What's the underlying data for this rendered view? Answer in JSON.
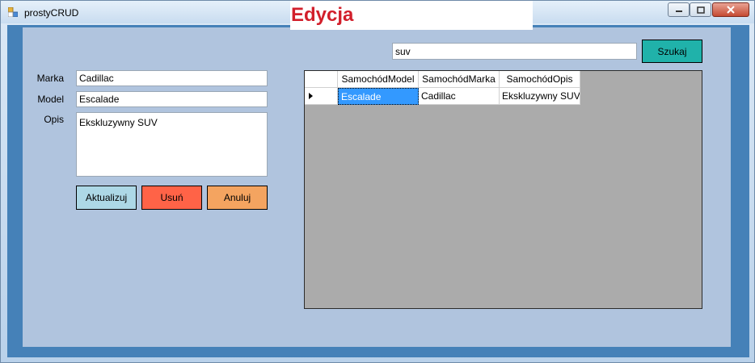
{
  "window": {
    "title": "prostyCRUD",
    "heading": "Edycja"
  },
  "search": {
    "value": "suv",
    "button_label": "Szukaj"
  },
  "form": {
    "marka_label": "Marka",
    "marka_value": "Cadillac",
    "model_label": "Model",
    "model_value": "Escalade",
    "opis_label": "Opis",
    "opis_value": "Ekskluzywny SUV",
    "update_label": "Aktualizuj",
    "delete_label": "Usuń",
    "cancel_label": "Anuluj"
  },
  "grid": {
    "columns": [
      "SamochódModel",
      "SamochódMarka",
      "SamochódOpis"
    ],
    "rows": [
      [
        "Escalade",
        "Cadillac",
        "Ekskluzywny SUV"
      ]
    ]
  },
  "colors": {
    "heading": "#d21f2b",
    "search_button": "#20b2aa",
    "update_button": "#add8e6",
    "delete_button": "#ff6347",
    "cancel_button": "#f4a460",
    "selection": "#3399ff",
    "client_bg": "#b0c4de",
    "border": "#4581b8"
  }
}
